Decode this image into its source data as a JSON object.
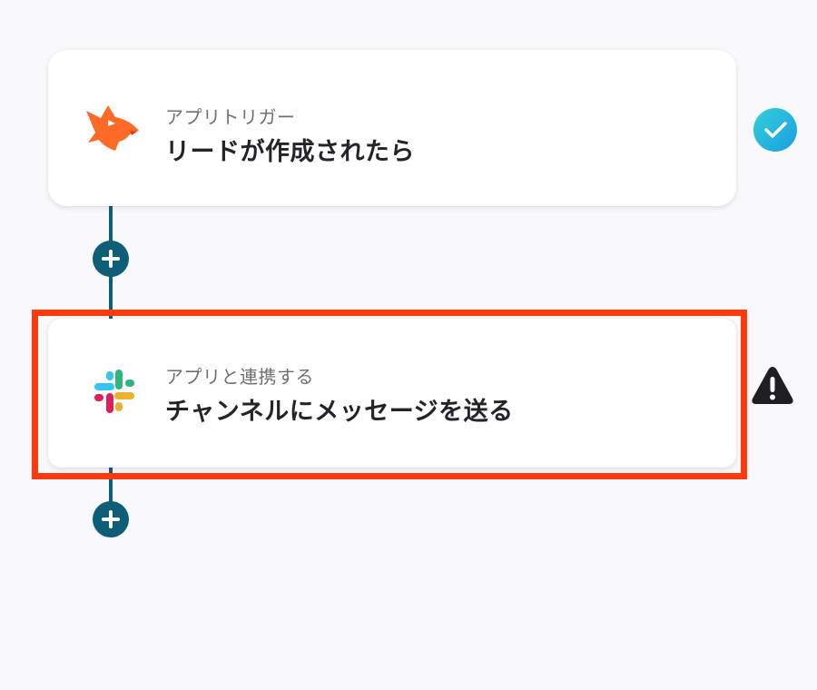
{
  "flow": {
    "steps": [
      {
        "subtitle": "アプリトリガー",
        "title": "リードが作成されたら",
        "icon": "fox-app-icon",
        "status": "check-icon"
      },
      {
        "subtitle": "アプリと連携する",
        "title": "チャンネルにメッセージを送る",
        "icon": "slack-icon",
        "status": "warning-icon"
      }
    ],
    "add_step_icon": "plus-icon"
  },
  "colors": {
    "background": "#f9f8fb",
    "connector": "#0f5e78",
    "highlight": "#ff3a0e",
    "fox": "#ff6a26",
    "check_start": "#2ec7dd",
    "check_end": "#1aa2e0",
    "warning": "#1f1f22"
  }
}
